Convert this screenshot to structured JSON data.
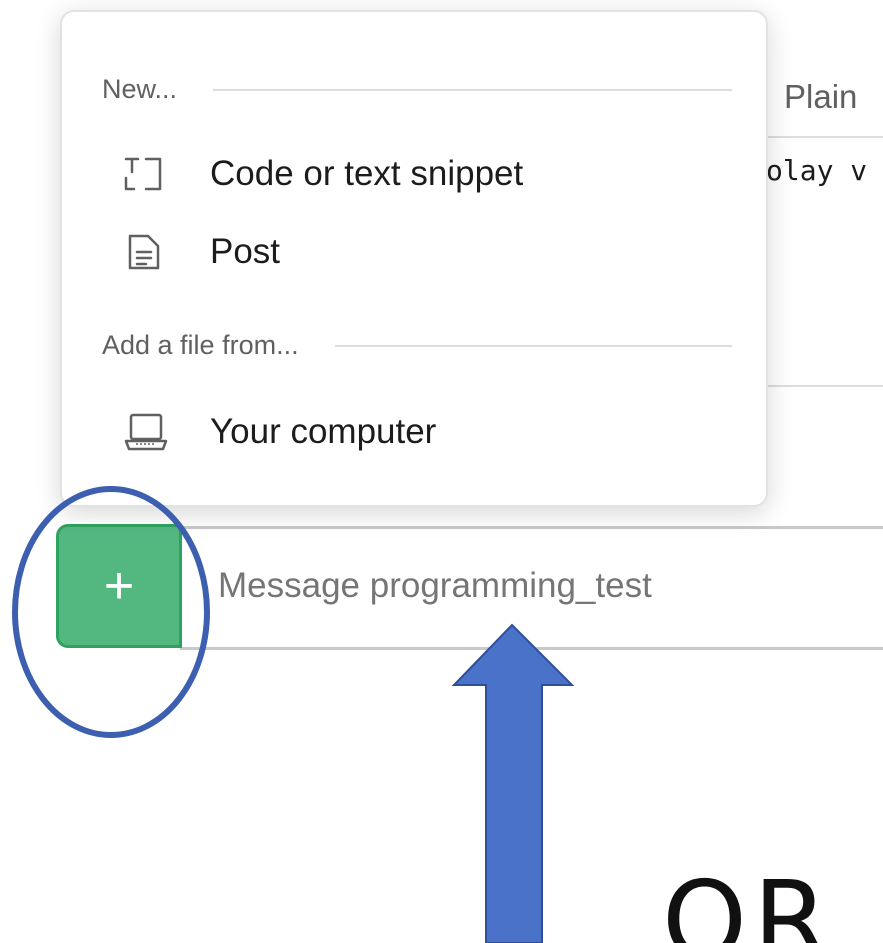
{
  "background": {
    "format_label": "Plain",
    "code_fragment": "olay v"
  },
  "menu": {
    "sections": [
      {
        "label": "New...",
        "items": [
          {
            "label": "Code or text snippet",
            "icon": "text-snippet-icon"
          },
          {
            "label": "Post",
            "icon": "document-icon"
          }
        ]
      },
      {
        "label": "Add a file from...",
        "items": [
          {
            "label": "Your computer",
            "icon": "laptop-icon"
          }
        ]
      }
    ]
  },
  "composer": {
    "plus_label": "+",
    "placeholder": "Message programming_test"
  },
  "annotation": {
    "or_text": "OR",
    "circle_color": "#3d5fb0",
    "arrow_color": "#4a72c8"
  },
  "colors": {
    "plus_button_bg": "#52b880",
    "plus_button_border": "#2fa25f"
  }
}
